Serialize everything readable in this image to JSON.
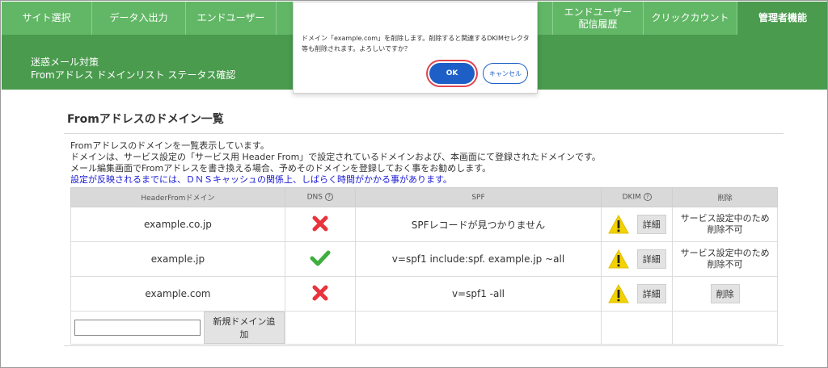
{
  "nav": {
    "items": [
      {
        "label": "サイト選択",
        "width": 112
      },
      {
        "label": "データ入出力",
        "width": 116
      },
      {
        "label": "エンドユーザー",
        "width": 112
      }
    ],
    "right_items": [
      {
        "label": "エンドユーザー\n配信履歴",
        "width": 112
      },
      {
        "label": "クリックカウント",
        "width": 116
      }
    ],
    "active": {
      "label": "管理者機能",
      "width": 112
    }
  },
  "band": {
    "line1": "迷惑メール対策",
    "line2": "Fromアドレス ドメインリスト ステータス確認"
  },
  "page": {
    "heading": "Fromアドレスのドメイン一覧",
    "desc1": "Fromアドレスのドメインを一覧表示しています。",
    "desc2": "ドメインは、サービス設定の「サービス用 Header From」で設定されているドメインおよび、本画面にて登録されたドメインです。",
    "desc3": "メール編集画面でFromアドレスを書き換える場合、予めそのドメインを登録しておく事をお勧めします。",
    "note": "設定が反映されるまでには、ＤＮＳキャッシュの関係上、しばらく時間がかかる事があります。"
  },
  "table": {
    "headers": {
      "domain": "HeaderFromドメイン",
      "dns": "DNS",
      "spf": "SPF",
      "dkim": "DKIM",
      "delete": "削除"
    },
    "help_glyph": "?",
    "detail_label": "詳細",
    "rows": [
      {
        "domain": "example.co.jp",
        "dns": "fail",
        "spf": "SPFレコードが見つかりません",
        "delete_text": "サービス設定中のため\n削除不可",
        "deletable": false
      },
      {
        "domain": "example.jp",
        "dns": "ok",
        "spf": "v=spf1 include:spf. example.jp  ~all",
        "delete_text": "サービス設定中のため\n削除不可",
        "deletable": false
      },
      {
        "domain": "example.com",
        "dns": "fail",
        "spf": "v=spf1 -all",
        "delete_text": "削除",
        "deletable": true
      }
    ],
    "add_button": "新規ドメイン追加",
    "add_input_value": ""
  },
  "dialog": {
    "message": "ドメイン「example.com」を削除します。削除すると関連するDKIMセレクタ等も削除されます。よろしいですか？",
    "ok": "OK",
    "cancel": "キャンセル"
  },
  "colors": {
    "nav_green": "#62b766",
    "band_green": "#4a9b4e",
    "ok_blue": "#1e5fc7",
    "fail_red": "#e8343c",
    "ok_green": "#3fae3f",
    "warn_yellow": "#f2d200"
  }
}
